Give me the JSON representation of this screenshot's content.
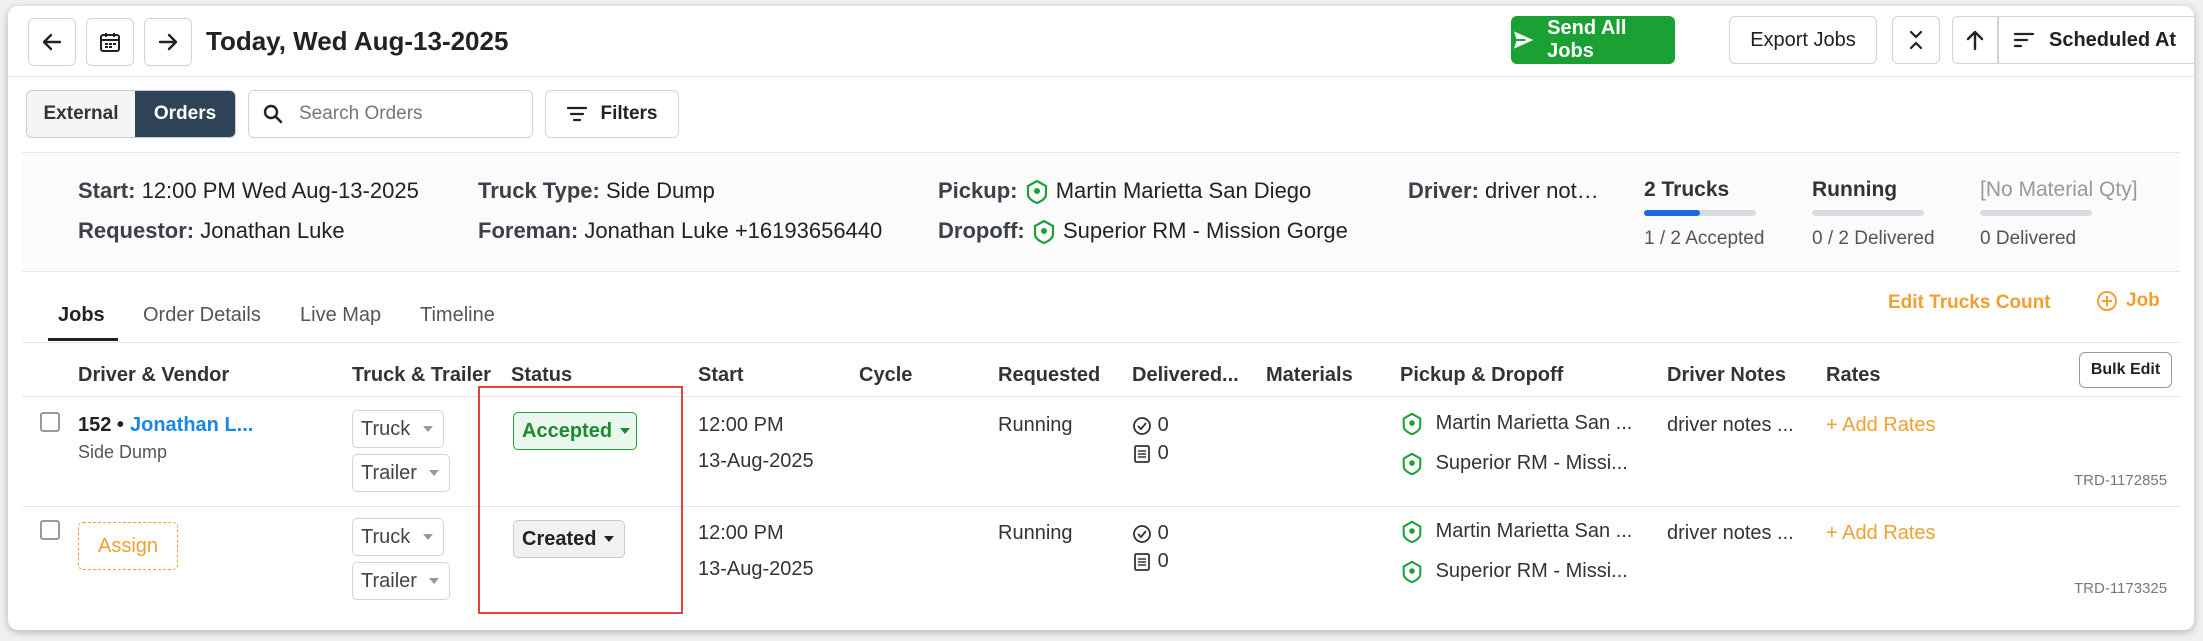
{
  "header": {
    "date_title": "Today, Wed Aug-13-2025",
    "send_all_label": "Send All Jobs",
    "export_label": "Export Jobs",
    "sort_label": "Scheduled At"
  },
  "toolbar": {
    "toggle_external": "External",
    "toggle_orders": "Orders",
    "search_placeholder": "Search Orders",
    "filters_label": "Filters"
  },
  "order": {
    "start_label": "Start:",
    "start_value": "12:00 PM Wed Aug-13-2025",
    "requestor_label": "Requestor:",
    "requestor_value": "Jonathan Luke",
    "truck_type_label": "Truck Type:",
    "truck_type_value": "Side Dump",
    "foreman_label": "Foreman:",
    "foreman_value": "Jonathan Luke +16193656440",
    "pickup_label": "Pickup:",
    "pickup_value": "Martin Marietta San Diego",
    "dropoff_label": "Dropoff:",
    "dropoff_value": "Superior RM - Mission Gorge",
    "driver_label": "Driver:",
    "driver_value": "driver not…",
    "stats": {
      "trucks_title": "2 Trucks",
      "trucks_sub": "1 / 2 Accepted",
      "trucks_progress": 0.5,
      "running_title": "Running",
      "running_sub": "0 / 2 Delivered",
      "running_progress": 0,
      "material_title": "[No Material Qty]",
      "material_sub": "0 Delivered",
      "material_progress": 0
    }
  },
  "tabs": [
    "Jobs",
    "Order Details",
    "Live Map",
    "Timeline"
  ],
  "actions": {
    "edit_trucks": "Edit Trucks Count",
    "add_job": "Job",
    "bulk_edit": "Bulk Edit"
  },
  "columns": [
    "Driver & Vendor",
    "Truck & Trailer",
    "Status",
    "Start",
    "Cycle",
    "Requested",
    "Delivered...",
    "Materials",
    "Pickup & Dropoff",
    "Driver Notes",
    "Rates"
  ],
  "rows": [
    {
      "driver_id": "152 •",
      "driver_name": "Jonathan L...",
      "vendor": "Side Dump",
      "truck": "Truck",
      "trailer": "Trailer",
      "status": "Accepted",
      "start_time": "12:00 PM",
      "start_date": "13-Aug-2025",
      "requested": "Running",
      "delivered_loads": "0",
      "delivered_tickets": "0",
      "pickup": "Martin Marietta San ...",
      "dropoff": "Superior RM - Missi...",
      "notes": "driver notes ...",
      "rates": "+ Add Rates",
      "trd": "TRD-1172855"
    },
    {
      "assign_label": "Assign",
      "truck": "Truck",
      "trailer": "Trailer",
      "status": "Created",
      "start_time": "12:00 PM",
      "start_date": "13-Aug-2025",
      "requested": "Running",
      "delivered_loads": "0",
      "delivered_tickets": "0",
      "pickup": "Martin Marietta San ...",
      "dropoff": "Superior RM - Missi...",
      "notes": "driver notes ...",
      "rates": "+ Add Rates",
      "trd": "TRD-1173325"
    }
  ],
  "colors": {
    "green": "#1aa033",
    "navy": "#2f4356",
    "orange": "#f0a030",
    "link_blue": "#1a88e0",
    "highlight_red": "#e0453c"
  }
}
